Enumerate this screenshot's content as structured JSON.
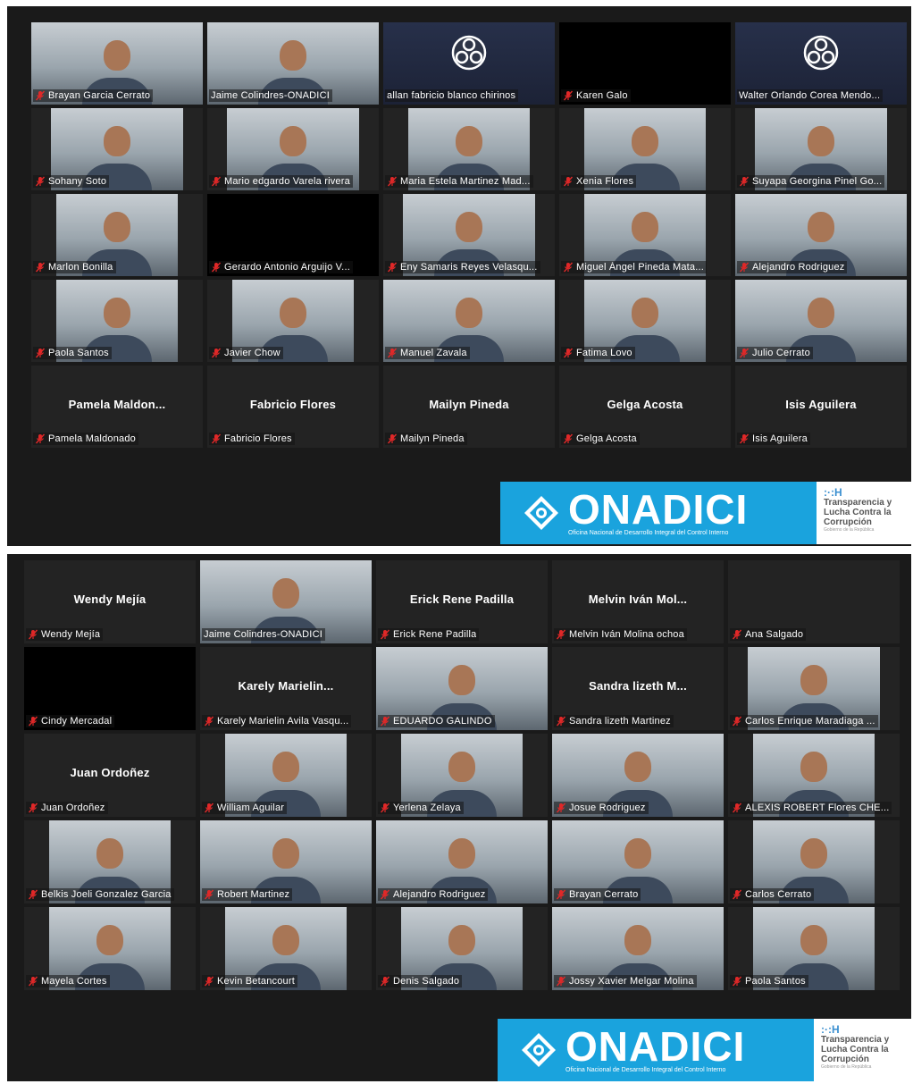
{
  "screens": [
    {
      "tiles": [
        {
          "name": "Brayan Garcia Cerrato",
          "kind": "cam",
          "muted": true,
          "video": "wide"
        },
        {
          "name": "Jaime Colindres-ONADICI",
          "kind": "cam",
          "muted": false,
          "active": true,
          "video": "wide"
        },
        {
          "name": "allan fabricio blanco chirinos",
          "kind": "obs",
          "muted": false
        },
        {
          "name": "Karen Galo",
          "kind": "blank",
          "muted": true
        },
        {
          "name": "Walter Orlando Corea Mendo...",
          "kind": "obs",
          "muted": false
        },
        {
          "name": "Sohany Soto",
          "kind": "cam",
          "muted": true,
          "video": "medium"
        },
        {
          "name": "Mario edgardo Varela rivera",
          "kind": "cam",
          "muted": true,
          "video": "medium"
        },
        {
          "name": "Maria Estela Martinez Mad...",
          "kind": "cam",
          "muted": true,
          "video": "narrow"
        },
        {
          "name": "Xenia Flores",
          "kind": "cam",
          "muted": true,
          "video": "narrow"
        },
        {
          "name": "Suyapa Georgina Pinel Go...",
          "kind": "cam",
          "muted": true,
          "video": "medium"
        },
        {
          "name": "Marlon Bonilla",
          "kind": "cam",
          "muted": true,
          "video": "narrow"
        },
        {
          "name": "Gerardo Antonio Arguijo V...",
          "kind": "blank",
          "muted": true
        },
        {
          "name": "Eny Samaris Reyes Velasqu...",
          "kind": "cam",
          "muted": true,
          "video": "medium"
        },
        {
          "name": "Miguel Ángel Pineda Mata...",
          "kind": "cam",
          "muted": true,
          "video": "narrow"
        },
        {
          "name": "Alejandro Rodriguez",
          "kind": "cam",
          "muted": true,
          "video": "wide"
        },
        {
          "name": "Paola Santos",
          "kind": "cam",
          "muted": true,
          "video": "narrow"
        },
        {
          "name": "Javier Chow",
          "kind": "cam",
          "muted": true,
          "video": "narrow"
        },
        {
          "name": "Manuel Zavala",
          "kind": "cam",
          "muted": true,
          "video": "wide"
        },
        {
          "name": "Fatima Lovo",
          "kind": "cam",
          "muted": true,
          "video": "narrow"
        },
        {
          "name": "Julio Cerrato",
          "kind": "cam",
          "muted": true,
          "video": "wide"
        },
        {
          "name": "Pamela Maldonado",
          "kind": "text",
          "display": "Pamela  Maldon...",
          "muted": true
        },
        {
          "name": "Fabricio Flores",
          "kind": "text",
          "display": "Fabricio Flores",
          "muted": true
        },
        {
          "name": "Mailyn Pineda",
          "kind": "text",
          "display": "Mailyn Pineda",
          "muted": true
        },
        {
          "name": "Gelga Acosta",
          "kind": "text",
          "display": "Gelga Acosta",
          "muted": true
        },
        {
          "name": "Isis Aguilera",
          "kind": "text",
          "display": "Isis Aguilera",
          "muted": true
        }
      ]
    },
    {
      "tiles": [
        {
          "name": "Wendy Mejía",
          "kind": "text",
          "display": "Wendy Mejía",
          "muted": true
        },
        {
          "name": "Jaime Colindres-ONADICI",
          "kind": "cam",
          "muted": false,
          "active": true,
          "video": "wide"
        },
        {
          "name": "Erick Rene Padilla",
          "kind": "text",
          "display": "Erick Rene Padilla",
          "muted": true
        },
        {
          "name": "Melvin Iván Molina ochoa",
          "kind": "text",
          "display": "Melvin  Iván  Mol...",
          "muted": true
        },
        {
          "name": "Ana Salgado",
          "kind": "text",
          "display": "",
          "muted": true
        },
        {
          "name": "Cindy Mercadal",
          "kind": "blank",
          "muted": true
        },
        {
          "name": "Karely Marielin Avila Vasqu...",
          "kind": "text",
          "display": "Karely  Marielin...",
          "muted": true
        },
        {
          "name": "EDUARDO GALINDO",
          "kind": "cam",
          "muted": true,
          "video": "wide"
        },
        {
          "name": "Sandra lizeth Martinez",
          "kind": "text",
          "display": "Sandra  lizeth  M...",
          "muted": true
        },
        {
          "name": "Carlos Enrique Maradiaga ...",
          "kind": "cam",
          "muted": true,
          "video": "medium"
        },
        {
          "name": "Juan Ordoñez",
          "kind": "text",
          "display": "Juan Ordoñez",
          "muted": true
        },
        {
          "name": "William Aguilar",
          "kind": "cam",
          "muted": true,
          "video": "narrow"
        },
        {
          "name": "Yerlena Zelaya",
          "kind": "cam",
          "muted": true,
          "video": "narrow"
        },
        {
          "name": "Josue Rodriguez",
          "kind": "cam",
          "muted": true,
          "video": "wide"
        },
        {
          "name": "ALEXIS ROBERT Flores CHE...",
          "kind": "cam",
          "muted": true,
          "video": "narrow"
        },
        {
          "name": "Belkis Joeli Gonzalez Garcia",
          "kind": "cam",
          "muted": true,
          "video": "narrow"
        },
        {
          "name": "Robert Martinez",
          "kind": "cam",
          "muted": true,
          "video": "wide"
        },
        {
          "name": "Alejandro Rodriguez",
          "kind": "cam",
          "muted": true,
          "video": "wide"
        },
        {
          "name": "Brayan Cerrato",
          "kind": "cam",
          "muted": true,
          "video": "wide"
        },
        {
          "name": "Carlos Cerrato",
          "kind": "cam",
          "muted": true,
          "video": "narrow"
        },
        {
          "name": "Mayela Cortes",
          "kind": "cam",
          "muted": true,
          "video": "narrow"
        },
        {
          "name": "Kevin Betancourt",
          "kind": "cam",
          "muted": true,
          "video": "narrow"
        },
        {
          "name": "Denis Salgado",
          "kind": "cam",
          "muted": true,
          "video": "narrow"
        },
        {
          "name": "Jossy Xavier Melgar Molina",
          "kind": "cam",
          "muted": true,
          "video": "wide"
        },
        {
          "name": "Paola Santos",
          "kind": "cam",
          "muted": true,
          "video": "narrow"
        }
      ]
    }
  ],
  "banner": {
    "brand": "ONADICI",
    "subtitle": "Oficina Nacional de Desarrollo Integral del Control Interno",
    "partner_mark": ":·:H",
    "partner_line1": "Transparencia y",
    "partner_line2": "Lucha Contra la",
    "partner_line3": "Corrupción",
    "partner_small": "Gobierno de la República"
  },
  "icons": {
    "muted": "microphone-muted-icon",
    "obs": "obs-logo-icon",
    "brand": "onadici-diamond-icon"
  },
  "colors": {
    "active_speaker": "#b6e356",
    "mute_red": "#e02828",
    "brand_blue": "#1aa3dd",
    "tile_bg": "#232323",
    "app_bg": "#1a1a1a"
  }
}
